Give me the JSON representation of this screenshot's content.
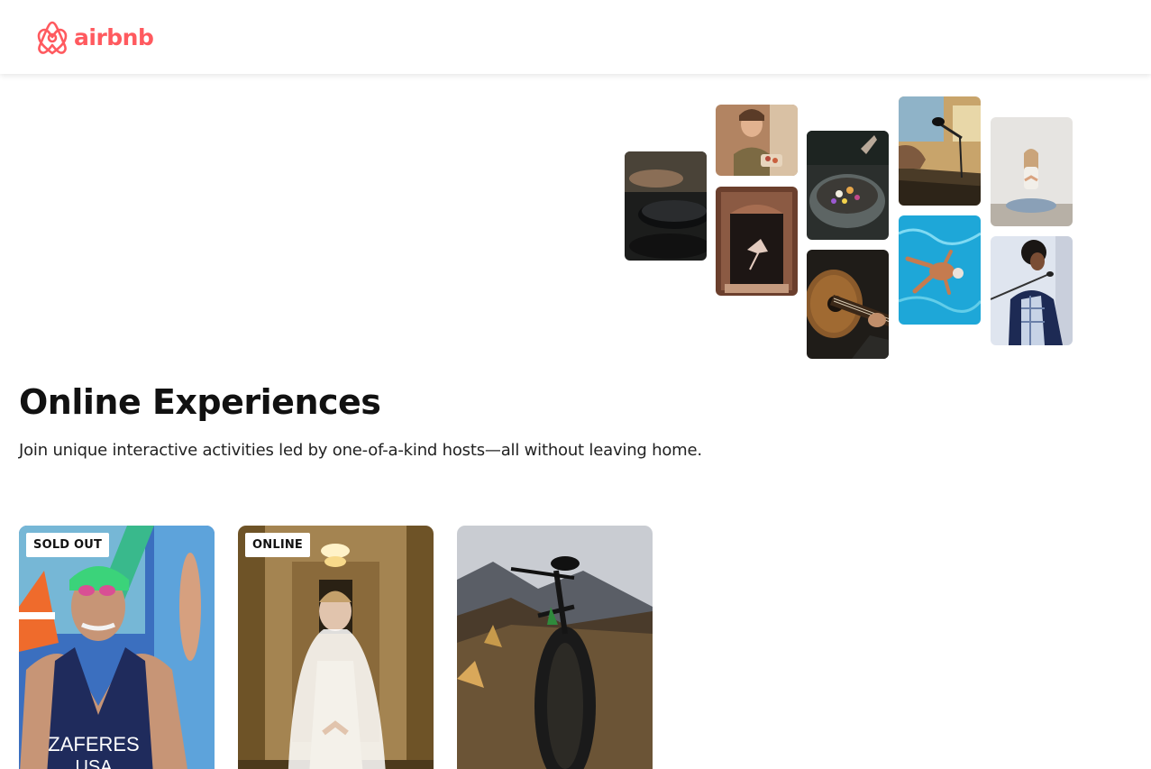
{
  "brand": {
    "name": "airbnb",
    "color": "#FF5A5F"
  },
  "hero": {
    "title": "Online Experiences",
    "subtitle": "Join unique interactive activities led by one-of-a-kind hosts—all without leaving home."
  },
  "photo_grid": [
    {
      "subject": "cooking-pans"
    },
    {
      "subject": "woman-serving-food"
    },
    {
      "subject": "dancer-in-doorway"
    },
    {
      "subject": "food-bowl"
    },
    {
      "subject": "guitar-player"
    },
    {
      "subject": "keyboard-microphone"
    },
    {
      "subject": "swimmer-pool"
    },
    {
      "subject": "yoga-woman"
    },
    {
      "subject": "singer-microphone"
    }
  ],
  "cards": [
    {
      "badge": "SOLD OUT",
      "subject": "triathlete-zaferes"
    },
    {
      "badge": "ONLINE",
      "subject": "bride-in-hall"
    },
    {
      "badge": "",
      "subject": "mountain-bike"
    }
  ],
  "card_print": {
    "swimsuit_text": "ZAFERES",
    "swimsuit_text2": "USA"
  }
}
